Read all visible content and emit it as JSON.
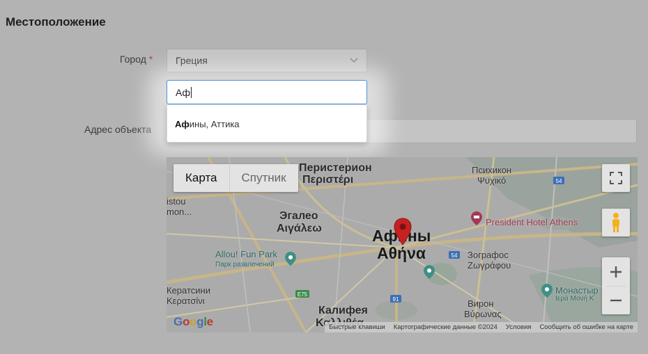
{
  "section": {
    "title": "Местоположение"
  },
  "city": {
    "label": "Город",
    "required_mark": "*",
    "select_value": "Греция",
    "search_value": "Аф"
  },
  "suggestion": {
    "match": "Аф",
    "rest": "ины, Аттика"
  },
  "address": {
    "label": "Адрес объекта",
    "value": ""
  },
  "map": {
    "type_buttons": {
      "map": "Карта",
      "satellite": "Спутник"
    },
    "labels": {
      "athens_ru": "Афины",
      "athens_gr": "Αθήνα",
      "peristeri_ru": "Перистерион",
      "peristeri_gr": "Περιστέρι",
      "psychiko_ru": "Психикон",
      "psychiko_gr": "Ψυχικό",
      "egaleo_ru": "Эгалео",
      "egaleo_gr": "Αιγάλεω",
      "zografos_ru": "Зографос",
      "zografos_gr": "Ζωγράφου",
      "keratsini_ru": "Кератсини",
      "keratsini_gr": "Κερατσίνι",
      "kallithea_ru": "Калифея",
      "kallithea_gr": "Καλλιθέα",
      "vyronas_ru": "Вирон",
      "vyronas_gr": "Βύρωνας",
      "edge_1": "istou",
      "edge_2": "mon...",
      "hotel": "President Hotel Athens",
      "fun_park": "Allou! Fun Park",
      "fun_park_sub": "Парк развлечений",
      "monastery": "Монастыр",
      "monastery_gr": "Ιερά Μονή Κ"
    },
    "road_shields": [
      "54",
      "54",
      "E75",
      "91"
    ],
    "attribution": {
      "shortcuts": "Быстрые клавиши",
      "data": "Картографические данные ©2024",
      "terms": "Условия",
      "report": "Сообщить об ошибке на карте"
    },
    "logo": "Google"
  },
  "colors": {
    "focus": "#4a8fd9",
    "required": "#c0392b",
    "pin": "#c5221f",
    "hotel": "#a23a54",
    "park": "#2d6a63"
  }
}
